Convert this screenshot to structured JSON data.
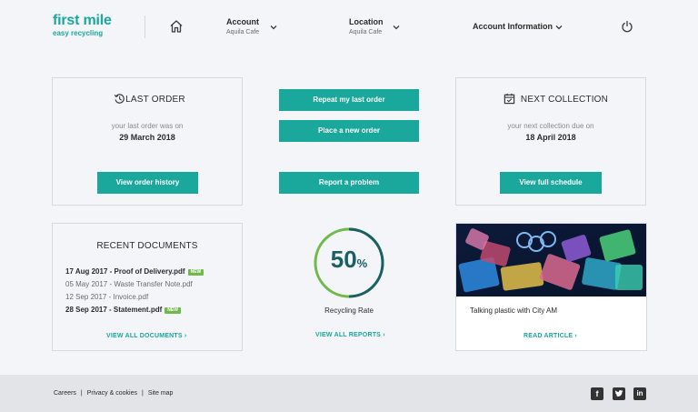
{
  "header": {
    "logo_main": "first mile",
    "logo_sub": "easy recycling",
    "account": {
      "title": "Account",
      "value": "Aquila Cafe"
    },
    "location": {
      "title": "Location",
      "value": "Aquila Cafe"
    },
    "account_info": "Account Information"
  },
  "last_order": {
    "title": "LAST ORDER",
    "subtitle": "your last order was on",
    "date": "29 March 2018",
    "button": "View order history"
  },
  "actions": {
    "repeat": "Repeat my last order",
    "new_order": "Place a new order",
    "report": "Report a problem"
  },
  "next_collection": {
    "title": "NEXT COLLECTION",
    "subtitle": "your next collection due on",
    "date": "18 April 2018",
    "button": "View full schedule"
  },
  "documents": {
    "title": "RECENT DOCUMENTS",
    "items": [
      {
        "text": "17 Aug 2017 - Proof of Delivery.pdf",
        "badge": "NEW"
      },
      {
        "text": "05 May 2017 - Waste Transfer Note.pdf"
      },
      {
        "text": "12 Sep 2017 - Invoice.pdf"
      },
      {
        "text": "28 Sep 2017 - Statement.pdf",
        "badge": "NEW"
      }
    ],
    "link": "VIEW ALL DOCUMENTS"
  },
  "recycling": {
    "value": "50",
    "unit": "%",
    "percent": 50,
    "label": "Recycling Rate",
    "link": "VIEW ALL REPORTS",
    "colors": {
      "ring": "#72b94b",
      "track": "#1b5f66"
    }
  },
  "article": {
    "title": "Talking plastic with City AM",
    "link": "READ ARTICLE"
  },
  "footer": {
    "links": [
      "Careers",
      "Privacy & cookies",
      "Site map"
    ],
    "social": [
      "facebook-icon",
      "twitter-icon",
      "linkedin-icon"
    ]
  },
  "colors": {
    "accent": "#1aa89d",
    "badge": "#72b94b"
  }
}
